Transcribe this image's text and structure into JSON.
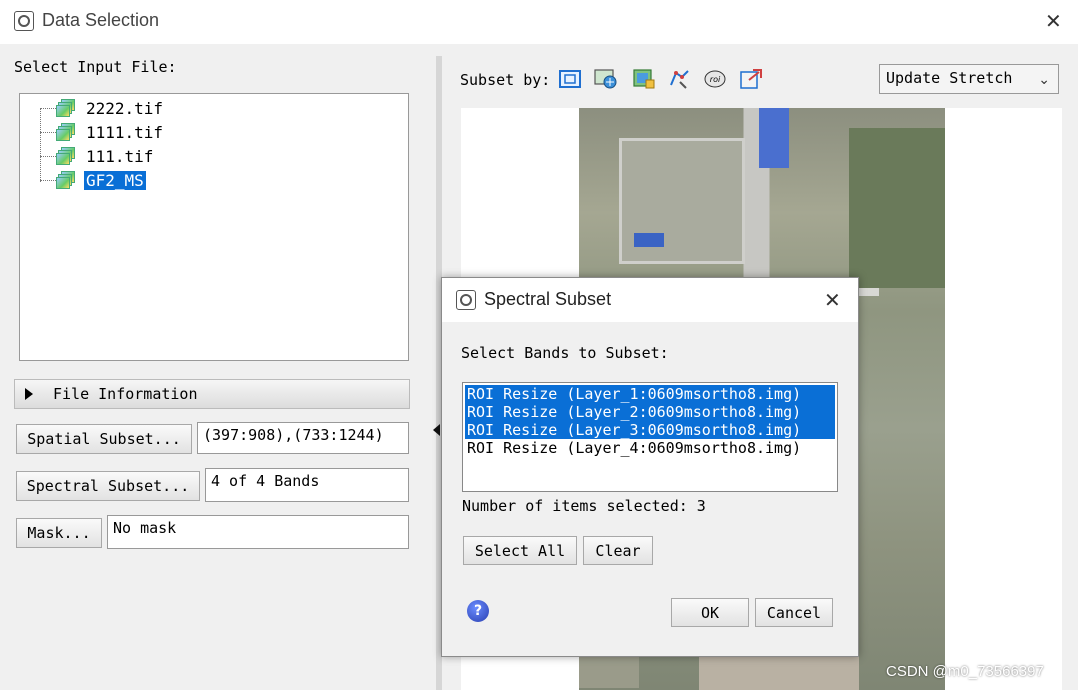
{
  "main_window": {
    "title": "Data Selection",
    "close_glyph": "✕"
  },
  "left_panel": {
    "select_input_label": "Select Input File:",
    "files": [
      {
        "label": "2222.tif",
        "selected": false
      },
      {
        "label": "1111.tif",
        "selected": false
      },
      {
        "label": "111.tif",
        "selected": false
      },
      {
        "label": "GF2_MS",
        "selected": true
      }
    ],
    "file_info_label": "File Information",
    "spatial_subset_button": "Spatial Subset...",
    "spatial_subset_value": "(397:908),(733:1244)",
    "spectral_subset_button": "Spectral Subset...",
    "spectral_subset_value": "4 of 4 Bands",
    "mask_button": "Mask...",
    "mask_value": "No mask"
  },
  "right_panel": {
    "subset_by_label": "Subset by:",
    "subset_tools": [
      "image-subset-icon",
      "map-subset-icon",
      "file-subset-icon",
      "vector-subset-icon",
      "roi-subset-icon",
      "scroll-subset-icon"
    ],
    "stretch_select_value": "Update Stretch"
  },
  "spectral_dialog": {
    "title": "Spectral Subset",
    "close_glyph": "✕",
    "select_bands_label": "Select Bands to Subset:",
    "bands": [
      {
        "label": "ROI Resize (Layer_1:0609msortho8.img)",
        "selected": true
      },
      {
        "label": "ROI Resize (Layer_2:0609msortho8.img)",
        "selected": true
      },
      {
        "label": "ROI Resize (Layer_3:0609msortho8.img)",
        "selected": true
      },
      {
        "label": "ROI Resize (Layer_4:0609msortho8.img)",
        "selected": false
      }
    ],
    "items_selected_label": "Number of items selected: 3",
    "select_all_button": "Select All",
    "clear_button": "Clear",
    "ok_button": "OK",
    "cancel_button": "Cancel",
    "help_glyph": "?"
  },
  "watermark": "CSDN @m0_73566397",
  "colors": {
    "selection": "#0a6fd6",
    "window_bg": "#f0f0f0"
  }
}
